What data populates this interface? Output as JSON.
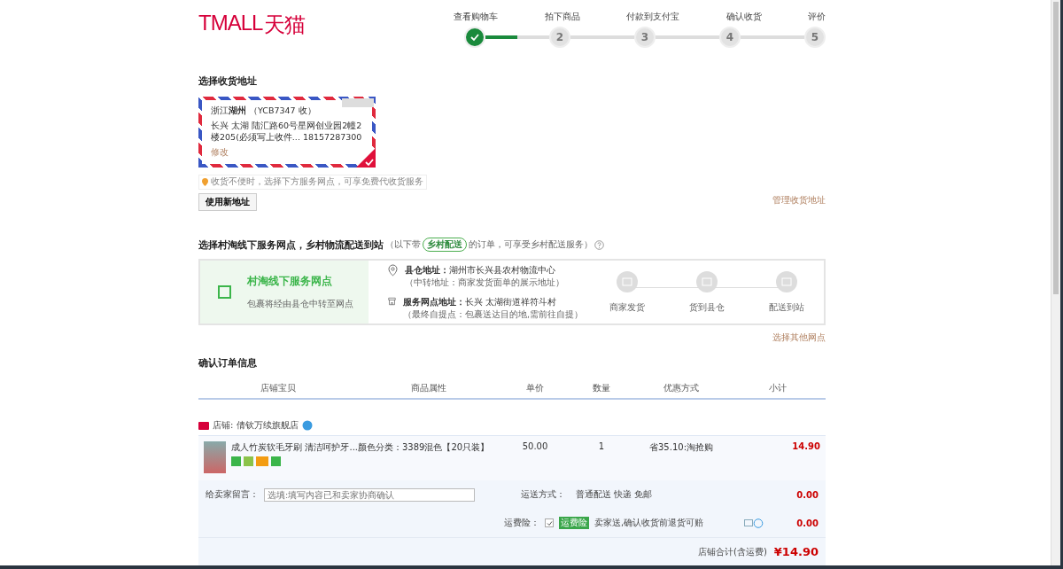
{
  "logo": {
    "latin": "TMALL",
    "cn": "天猫"
  },
  "steps": [
    {
      "label": "查看购物车",
      "done": true
    },
    {
      "label": "拍下商品",
      "number": "2",
      "done": false
    },
    {
      "label": "付款到支付宝",
      "number": "3",
      "done": false
    },
    {
      "label": "确认收货",
      "number": "4",
      "done": false
    },
    {
      "label": "评价",
      "number": "5",
      "done": false
    }
  ],
  "address": {
    "title": "选择收货地址",
    "card": {
      "region": "浙江",
      "city": "湖州",
      "recipient": "（YCB7347 收）",
      "detail": "长兴 太湖 陆汇路60号星网创业园2幢2楼205(必须写上收件... 18157287300",
      "edit": "修改",
      "selected": true
    },
    "tip": "收货不便时，选择下方服务网点，可享免费代收货服务",
    "new_button": "使用新地址",
    "manage_link": "管理收货地址"
  },
  "service": {
    "title": "选择村淘线下服务网点，乡村物流配送到站",
    "note_before": "（以下带",
    "tag": "乡村配送",
    "note_after": "的订单，可享受乡村配送服务）",
    "option": {
      "title": "村淘线下服务网点",
      "desc": "包裹将经由县仓中转至网点",
      "checked": false
    },
    "addresses": [
      {
        "kind": "pin",
        "label": "县仓地址：",
        "value": "湖州市长兴县农村物流中心",
        "note": "（中转地址：商家发货面单的展示地址）"
      },
      {
        "kind": "shop",
        "label": "服务网点地址：",
        "value": "长兴 太湖街道祥符斗村",
        "note": "（最终自提点：包裹送达目的地,需前往自提）"
      }
    ],
    "flow": [
      "商家发货",
      "货到县仓",
      "配送到站"
    ],
    "other_link": "选择其他网点"
  },
  "order": {
    "title": "确认订单信息",
    "columns": [
      "店铺宝贝",
      "商品属性",
      "单价",
      "数量",
      "优惠方式",
      "小计"
    ],
    "shop": "店铺: 倩钦万续旗舰店",
    "item": {
      "name": "成人竹炭软毛牙刷 清洁呵护牙...",
      "attr": "颜色分类：3389混色【20只装】",
      "price": "50.00",
      "qty": "1",
      "discount": "省35.10:淘抢购",
      "subtotal": "14.90"
    },
    "message": {
      "label": "给卖家留言：",
      "placeholder": "选填:填写内容已和卖家协商确认"
    },
    "shipping": {
      "label": "运送方式：",
      "value": "普通配送 快递 免邮",
      "cost": "0.00"
    },
    "insurance": {
      "label": "运费险：",
      "checked": true,
      "tag": "运费险",
      "text": "卖家送,确认收货前退货可赔",
      "cost": "0.00"
    },
    "total": {
      "label": "店铺合计(含运费)",
      "value": "¥14.90"
    }
  }
}
